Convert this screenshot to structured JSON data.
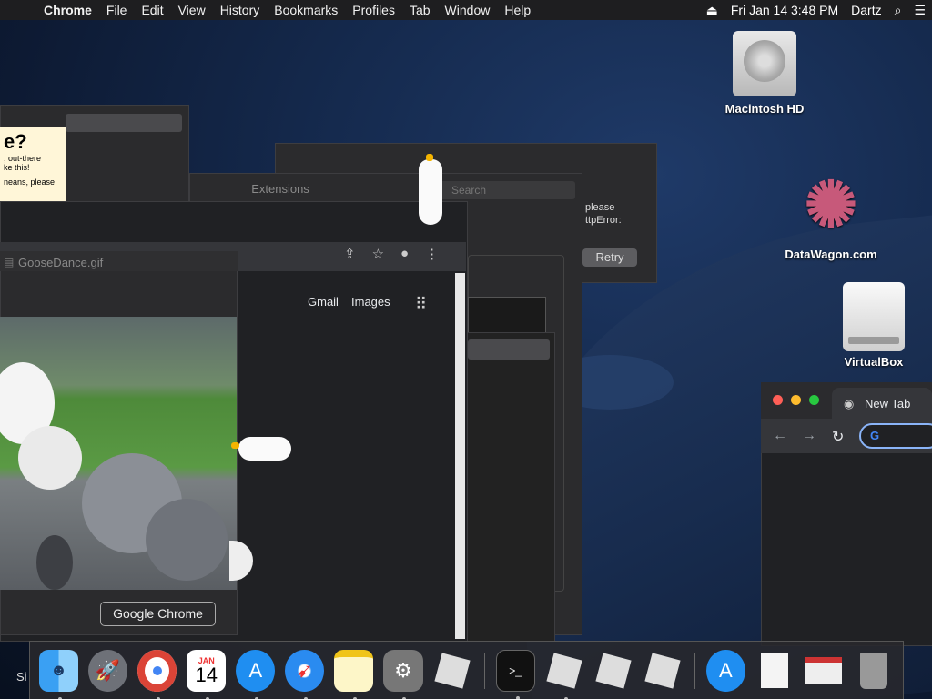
{
  "menubar": {
    "apple": "",
    "items": [
      "Chrome",
      "File",
      "Edit",
      "View",
      "History",
      "Bookmarks",
      "Profiles",
      "Tab",
      "Window",
      "Help"
    ],
    "right": {
      "eject": "⏏",
      "datetime": "Fri Jan 14  3:48 PM",
      "user": "Dartz"
    }
  },
  "desktop": {
    "icons": [
      "Macintosh HD",
      "DataWagon.com",
      "VirtualBox"
    ]
  },
  "windows": {
    "extensions_title": "Extensions",
    "search_placeholder": "Search",
    "error_text_1": "please",
    "error_text_2": "ttpError:",
    "retry": "Retry",
    "doc_big": "e?",
    "doc_line1": ", out-there",
    "doc_line2": "ke this!",
    "doc_line3": "neans, please",
    "gif_title": "GooseDance.gif",
    "gmail": "Gmail",
    "images": "Images",
    "newtab_title": "New Tab",
    "tooltip": "Google Chrome"
  },
  "dock": {
    "items": [
      "finder-icon",
      "launchpad-icon",
      "chrome-icon",
      "calendar-icon",
      "app-store-icon",
      "safari-icon",
      "notes-icon",
      "system-preferences-icon",
      "roblox-icon",
      "terminal-icon",
      "roblox-icon",
      "roblox-icon",
      "roblox-icon",
      "app-store-icon",
      "file-icon",
      "preview-icon",
      "trash-icon"
    ],
    "calendar_month": "JAN",
    "calendar_day": "14",
    "si": "Si"
  }
}
